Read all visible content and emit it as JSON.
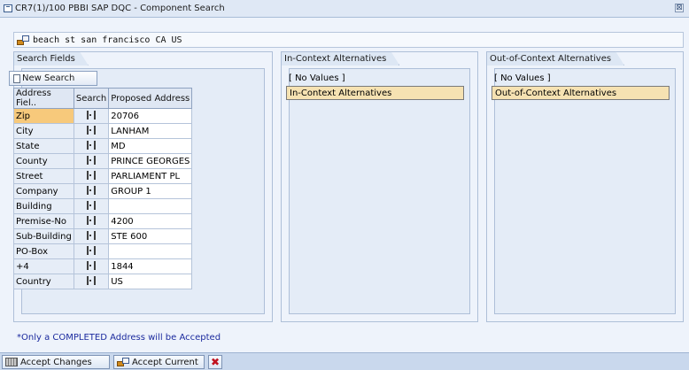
{
  "window": {
    "title": "CR7(1)/100 PBBI SAP DQC - Component Search",
    "close_glyph": "⊠"
  },
  "address_line": "beach st san francisco CA US",
  "panels": {
    "search": {
      "tab": "Search Fields",
      "new_search_label": "New Search"
    },
    "in_context": {
      "tab": "In-Context Alternatives",
      "no_values": "[ No Values ]",
      "selected": "In-Context Alternatives"
    },
    "out_context": {
      "tab": "Out-of-Context Alternatives",
      "no_values": "[ No Values ]",
      "selected": "Out-of-Context Alternatives"
    }
  },
  "table": {
    "headers": [
      "Address Fiel..",
      "Search",
      "Proposed Address"
    ],
    "rows": [
      {
        "field": "Zip",
        "value": "20706"
      },
      {
        "field": "City",
        "value": "LANHAM"
      },
      {
        "field": "State",
        "value": "MD"
      },
      {
        "field": "County",
        "value": "PRINCE GEORGES"
      },
      {
        "field": "Street",
        "value": "PARLIAMENT PL"
      },
      {
        "field": "Company",
        "value": "GROUP 1"
      },
      {
        "field": "Building",
        "value": ""
      },
      {
        "field": "Premise-No",
        "value": "4200"
      },
      {
        "field": "Sub-Building",
        "value": "STE 600"
      },
      {
        "field": "PO-Box",
        "value": ""
      },
      {
        "field": "+4",
        "value": "1844"
      },
      {
        "field": "Country",
        "value": "US"
      }
    ]
  },
  "footnote": "*Only a COMPLETED Address will be Accepted",
  "buttons": {
    "accept_changes": "Accept Changes",
    "accept_current": "Accept Current",
    "cancel_glyph": "✖"
  },
  "colors": {
    "selected_cell": "#f7c97b",
    "footnote_text": "#1b2a9e",
    "cancel_icon": "#c1121f"
  }
}
